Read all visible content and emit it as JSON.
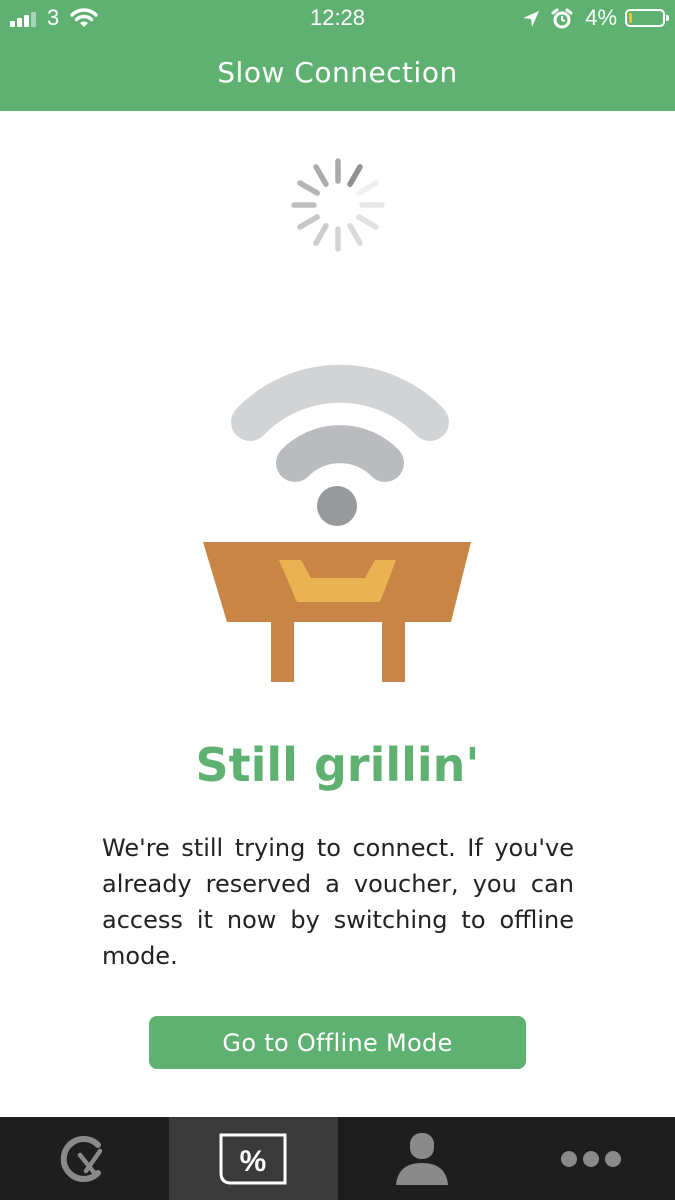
{
  "status_bar": {
    "carrier": "3",
    "time": "12:28",
    "battery_percent": "4%",
    "battery_level": 0.04,
    "icons": [
      "signal-icon",
      "wifi-icon",
      "location-arrow-icon",
      "alarm-icon",
      "battery-icon"
    ]
  },
  "header": {
    "title": "Slow Connection"
  },
  "content": {
    "heading": "Still grillin'",
    "message": "We're still trying to connect. If you've already reserved a voucher, you can access it now by switching to offline mode.",
    "button_label": "Go to Offline Mode"
  },
  "tabbar": {
    "tabs": [
      {
        "icon": "restaurant-clock-icon",
        "active": false
      },
      {
        "icon": "voucher-percent-icon",
        "active": true,
        "glyph": "%"
      },
      {
        "icon": "profile-icon",
        "active": false
      },
      {
        "icon": "more-dots-icon",
        "active": false
      }
    ]
  },
  "colors": {
    "brand_green": "#5fb172",
    "tabbar_bg": "#1e1e1e",
    "grill_brown": "#c98546",
    "grill_yellow": "#e9b352",
    "wifi_light": "#d1d3d5",
    "wifi_mid": "#b9bbbe",
    "wifi_dark": "#97999c"
  }
}
